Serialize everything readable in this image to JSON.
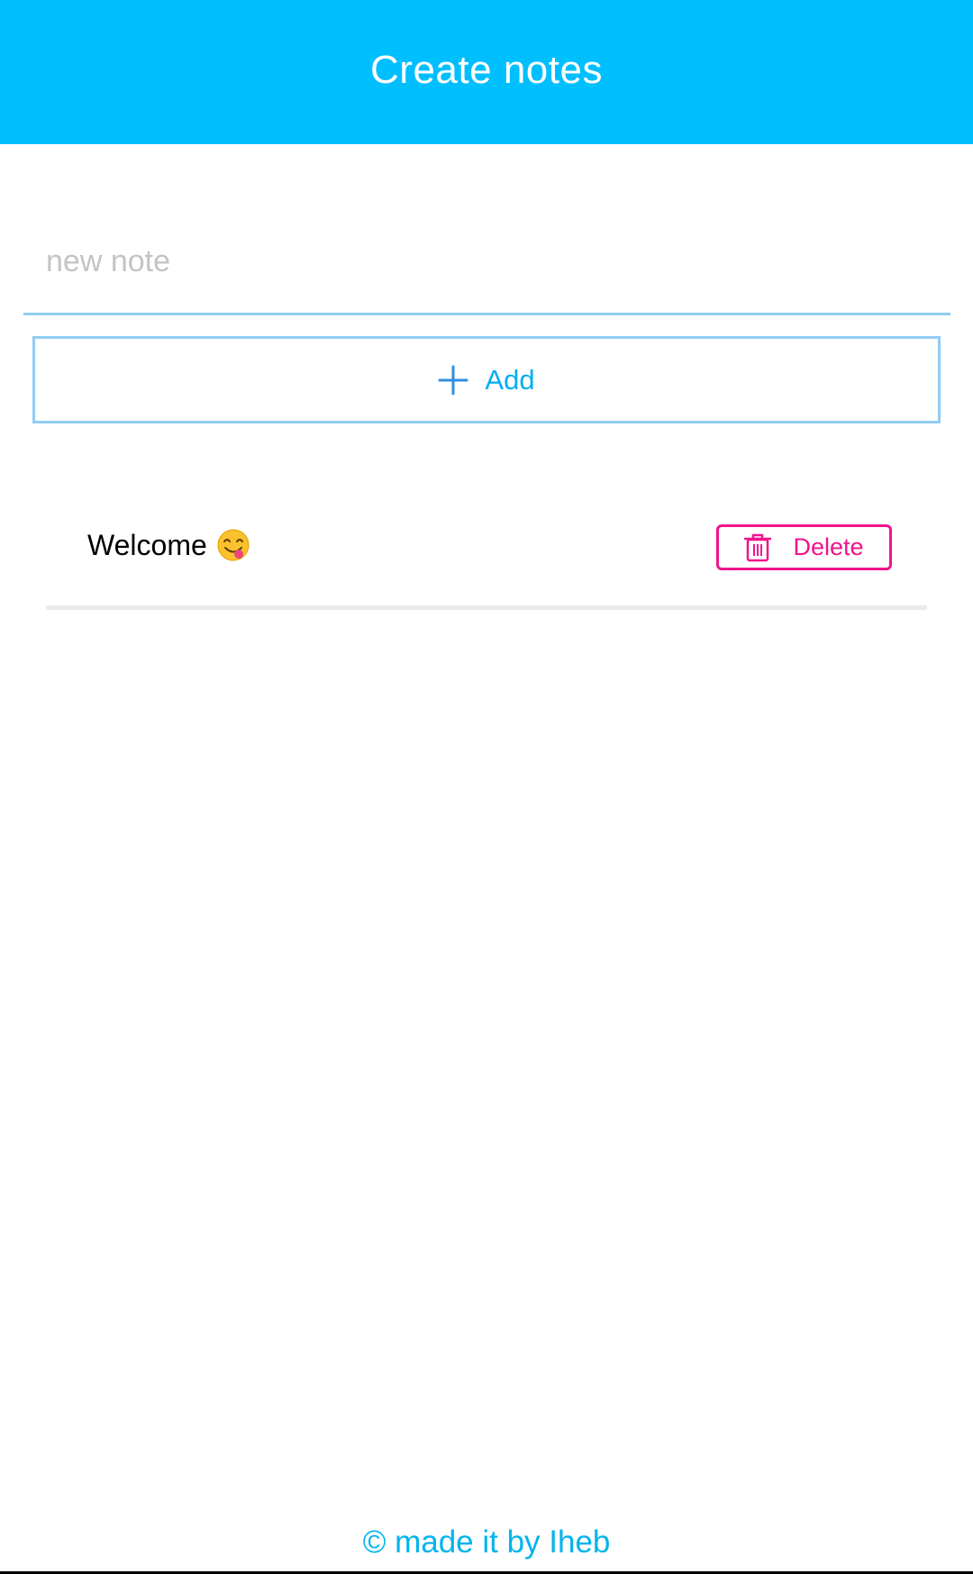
{
  "header": {
    "title": "Create notes"
  },
  "composer": {
    "placeholder": "new note",
    "value": "",
    "add_label": "Add"
  },
  "notes": [
    {
      "text": "Welcome",
      "emoji": "😋",
      "delete_label": "Delete"
    }
  ],
  "footer": {
    "text": "© made it by Iheb"
  },
  "colors": {
    "app_bar": "#00bfff",
    "accent": "#00aef0",
    "input_border": "#90cdf4",
    "delete": "#f0148c",
    "divider": "#ebebeb"
  },
  "icons": {
    "add": "plus-icon",
    "delete": "trash-icon",
    "emoji": "face-savoring-food-icon"
  }
}
